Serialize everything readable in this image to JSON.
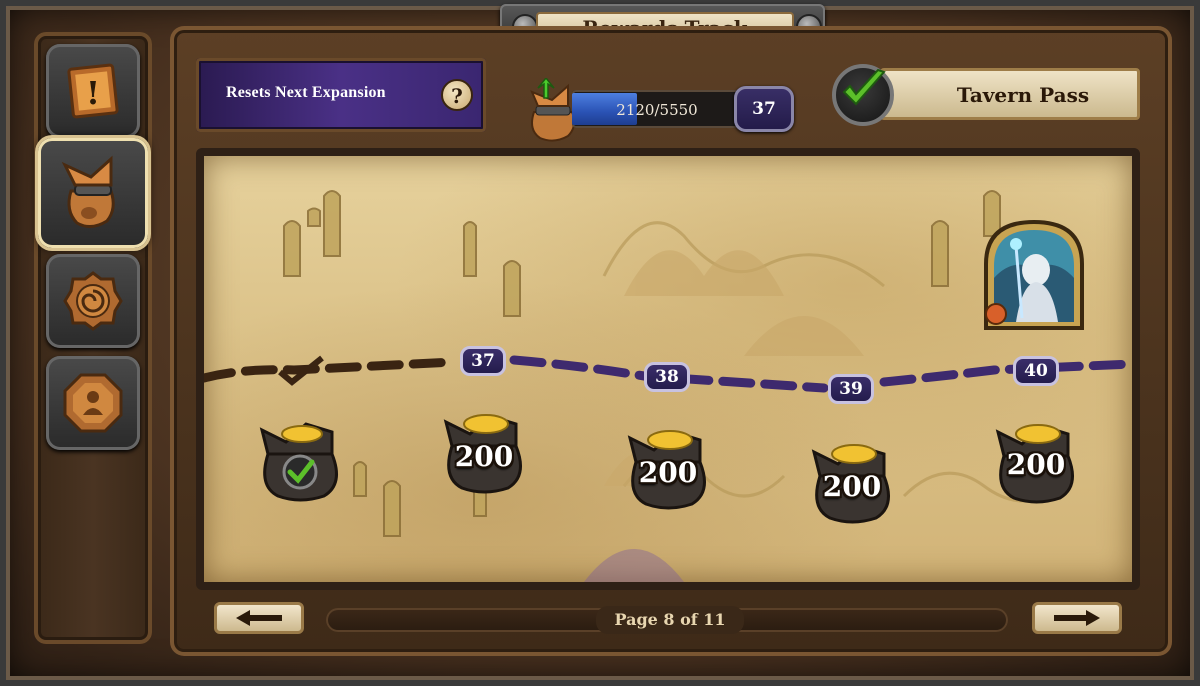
{
  "window": {
    "title": "Rewards Track"
  },
  "sidebar": {
    "tabs": [
      {
        "id": "quests",
        "icon": "quest-scroll-icon",
        "active": false
      },
      {
        "id": "rewards-track",
        "icon": "reward-bag-icon",
        "active": true
      },
      {
        "id": "events",
        "icon": "swirl-icon",
        "active": false
      },
      {
        "id": "profile",
        "icon": "achievement-icon",
        "active": false
      }
    ]
  },
  "header": {
    "reset_text": "Resets Next Expansion",
    "help_label": "?",
    "xp_text": "2120/5550",
    "xp_current": 2120,
    "xp_max": 5550,
    "level": "37",
    "tavern_pass_label": "Tavern Pass",
    "tavern_pass_owned": true
  },
  "track": {
    "levels": [
      {
        "label": "37"
      },
      {
        "label": "38"
      },
      {
        "label": "39"
      },
      {
        "label": "40"
      }
    ],
    "rewards": [
      {
        "type": "gold",
        "amount": "",
        "claimed": true
      },
      {
        "type": "gold",
        "amount": "200",
        "claimed": false
      },
      {
        "type": "gold",
        "amount": "200",
        "claimed": false
      },
      {
        "type": "gold",
        "amount": "200",
        "claimed": false
      },
      {
        "type": "gold",
        "amount": "200",
        "claimed": false
      }
    ],
    "hero_reward": {
      "icon": "hero-portrait-icon"
    }
  },
  "footer": {
    "page_label": "Page 8 of 11",
    "prev_icon": "arrow-left-icon",
    "next_icon": "arrow-right-icon"
  },
  "colors": {
    "accent_purple": "#3a2e6a",
    "xp_blue": "#2a52b4",
    "parchment": "#dcc38a",
    "check_green": "#5cbf2a"
  }
}
